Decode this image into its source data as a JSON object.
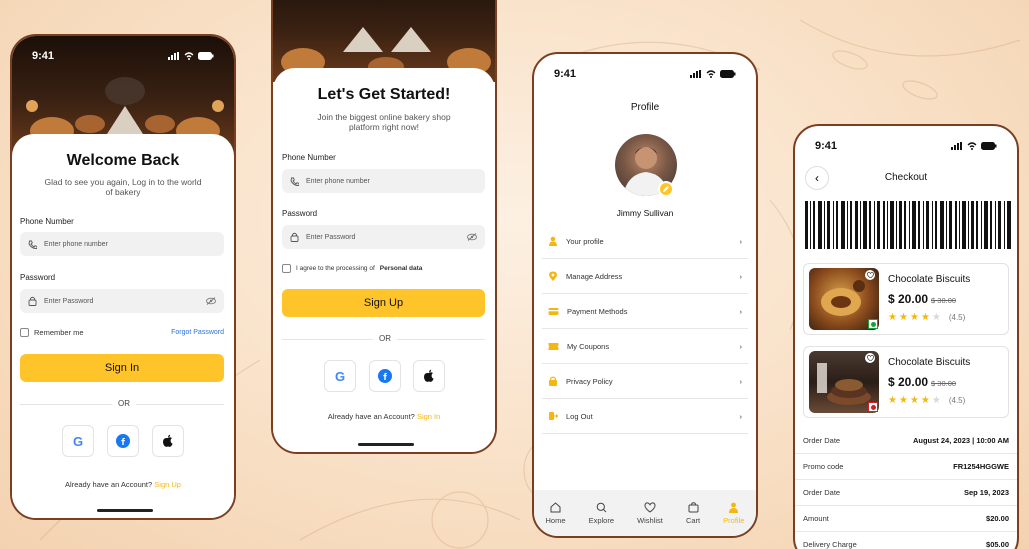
{
  "status_time": "9:41",
  "login": {
    "title": "Welcome Back",
    "subtitle": "Glad to see you again, Log in to the world of bakery",
    "phone_label": "Phone Number",
    "phone_placeholder": "Enter phone number",
    "password_label": "Password",
    "password_placeholder": "Enter Password",
    "remember": "Remember me",
    "forgot": "Forgot Password",
    "sign_in": "Sign In",
    "or": "OR",
    "footer_text": "Already have an Account?",
    "footer_link": "Sign Up"
  },
  "signup": {
    "title": "Let's Get Started!",
    "subtitle": "Join the biggest online bakery shop platform right now!",
    "phone_label": "Phone Number",
    "phone_placeholder": "Enter phone number",
    "password_label": "Password",
    "password_placeholder": "Enter Password",
    "agree_text": "I agree to the processing of",
    "agree_bold": "Personal data",
    "sign_up": "Sign Up",
    "or": "OR",
    "footer_text": "Already have an Account?",
    "footer_link": "Sign In"
  },
  "profile": {
    "title": "Profile",
    "name": "Jimmy Sullivan",
    "menu": [
      {
        "label": "Your profile",
        "icon": "user-icon"
      },
      {
        "label": "Manage Address",
        "icon": "location-icon"
      },
      {
        "label": "Payment Methods",
        "icon": "card-icon"
      },
      {
        "label": "My Coupons",
        "icon": "coupon-icon"
      },
      {
        "label": "Privacy Policy",
        "icon": "lock-icon"
      },
      {
        "label": "Log Out",
        "icon": "logout-icon"
      }
    ],
    "tabs": [
      {
        "label": "Home",
        "icon": "home-icon"
      },
      {
        "label": "Explore",
        "icon": "search-icon"
      },
      {
        "label": "Wishlist",
        "icon": "heart-icon"
      },
      {
        "label": "Cart",
        "icon": "cart-icon"
      },
      {
        "label": "Profile",
        "icon": "user-icon"
      }
    ]
  },
  "checkout": {
    "title": "Checkout",
    "products": [
      {
        "name": "Chocolate Biscuits",
        "price": "$ 20.00",
        "old_price": "$ 30.00",
        "rating": "(4.5)",
        "stars": 4,
        "badge_color": "#1a9e3a"
      },
      {
        "name": "Chocolate Biscuits",
        "price": "$ 20.00",
        "old_price": "$ 30.00",
        "rating": "(4.5)",
        "stars": 4,
        "badge_color": "#d51d1d"
      }
    ],
    "rows": [
      {
        "label": "Order Date",
        "value": "August 24, 2023 | 10:00 AM"
      },
      {
        "label": "Promo code",
        "value": "FR1254HGGWE"
      },
      {
        "label": "Order Date",
        "value": "Sep 19, 2023"
      },
      {
        "label": "Amount",
        "value": "$20.00"
      },
      {
        "label": "Delivery Charge",
        "value": "$05.00"
      }
    ]
  },
  "colors": {
    "accent": "#ffc42a",
    "frame": "#7a3f21",
    "link": "#f5b70f"
  }
}
